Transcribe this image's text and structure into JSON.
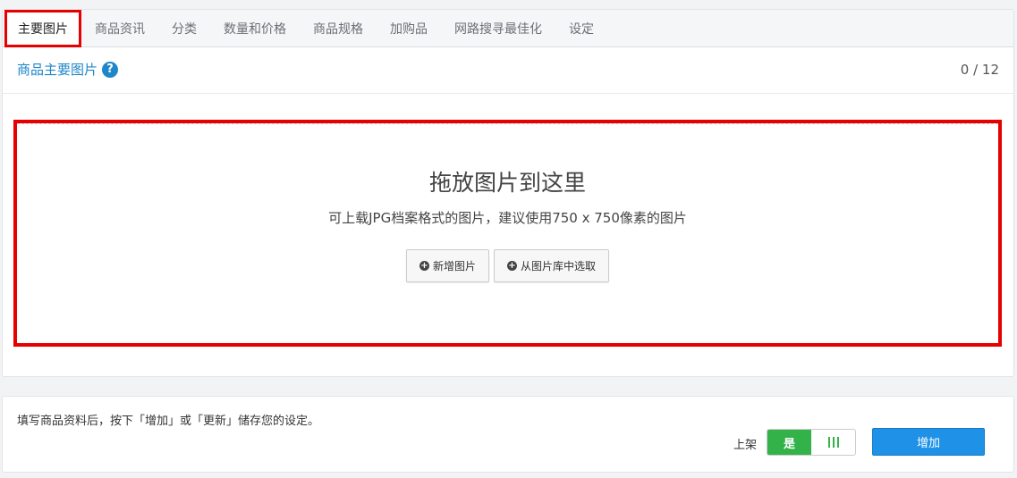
{
  "tabs": [
    {
      "label": "主要图片"
    },
    {
      "label": "商品资讯"
    },
    {
      "label": "分类"
    },
    {
      "label": "数量和价格"
    },
    {
      "label": "商品规格"
    },
    {
      "label": "加购品"
    },
    {
      "label": "网路搜寻最佳化"
    },
    {
      "label": "设定"
    }
  ],
  "active_tab": "主要图片",
  "section": {
    "title": "商品主要图片",
    "help_icon": "?",
    "counter": "0 / 12"
  },
  "dropzone": {
    "title": "拖放图片到这里",
    "description": "可上载JPG档案格式的图片，建议使用750 x 750像素的图片",
    "add_button": "新增图片",
    "library_button": "从图片库中选取",
    "plus_icon": "+"
  },
  "footer": {
    "note": "填写商品资料后，按下「增加」或「更新」储存您的设定。",
    "listing_label": "上架",
    "toggle_on": "是",
    "add_button": "增加"
  },
  "colors": {
    "accent_blue": "#1f86c9",
    "highlight_red": "#e60000",
    "toggle_green": "#33b249",
    "button_blue": "#1f92e8"
  }
}
